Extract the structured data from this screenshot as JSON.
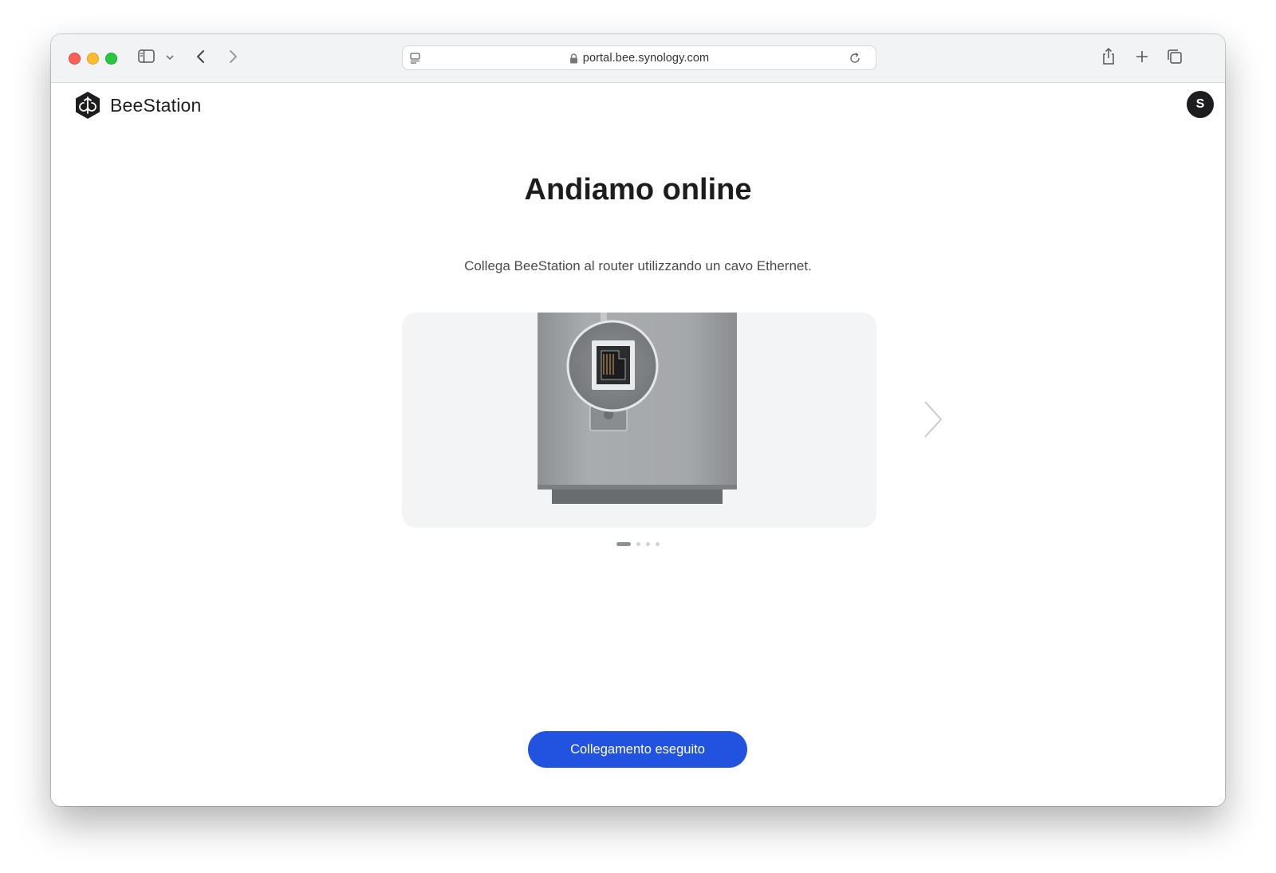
{
  "browser": {
    "url": "portal.bee.synology.com",
    "icons": [
      "sidebar-icon",
      "chevron-down-icon",
      "back-icon",
      "forward-icon",
      "page-menu-icon",
      "lock-icon",
      "reload-icon",
      "share-icon",
      "plus-icon",
      "tabs-icon"
    ]
  },
  "app": {
    "brand_name": "BeeStation",
    "avatar_initial": "S"
  },
  "main": {
    "title": "Andiamo online",
    "subtitle": "Collega BeeStation al router utilizzando un cavo Ethernet.",
    "carousel": {
      "slide_count": 4,
      "active_index": 0
    },
    "primary_button": "Collegamento eseguito"
  },
  "colors": {
    "accent": "#2152e0",
    "text_dark": "#1d1d1f"
  }
}
